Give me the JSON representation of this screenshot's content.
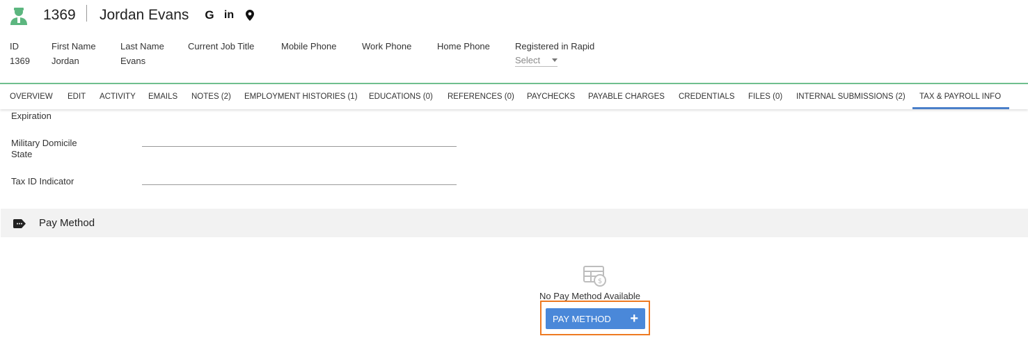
{
  "header": {
    "record_id": "1369",
    "name": "Jordan Evans",
    "social": {
      "google": "G",
      "linkedin": "in"
    }
  },
  "fields": {
    "id": {
      "label": "ID",
      "value": "1369"
    },
    "first_name": {
      "label": "First Name",
      "value": "Jordan"
    },
    "last_name": {
      "label": "Last Name",
      "value": "Evans"
    },
    "job_title": {
      "label": "Current Job Title",
      "value": ""
    },
    "mobile_phone": {
      "label": "Mobile Phone",
      "value": ""
    },
    "work_phone": {
      "label": "Work Phone",
      "value": ""
    },
    "home_phone": {
      "label": "Home Phone",
      "value": ""
    },
    "registered_rapid": {
      "label": "Registered in Rapid",
      "value": "Select"
    }
  },
  "tabs": [
    {
      "label": "OVERVIEW"
    },
    {
      "label": "EDIT"
    },
    {
      "label": "ACTIVITY"
    },
    {
      "label": "EMAILS"
    },
    {
      "label": "NOTES (2)"
    },
    {
      "label": "EMPLOYMENT HISTORIES (1)"
    },
    {
      "label": "EDUCATIONS (0)"
    },
    {
      "label": "REFERENCES (0)"
    },
    {
      "label": "PAYCHECKS"
    },
    {
      "label": "PAYABLE CHARGES"
    },
    {
      "label": "CREDENTIALS"
    },
    {
      "label": "FILES (0)"
    },
    {
      "label": "INTERNAL SUBMISSIONS (2)"
    },
    {
      "label": "TAX & PAYROLL INFO"
    }
  ],
  "tax_fields": {
    "expiration": "Expiration",
    "military_domicile_line1": "Military Domicile",
    "military_domicile_line2": "State",
    "tax_id_indicator": "Tax ID Indicator"
  },
  "pay_method": {
    "section_title": "Pay Method",
    "empty_text": "No Pay Method Available",
    "button_label": "PAY METHOD",
    "button_icon": "+"
  },
  "colors": {
    "accent_green": "#5cb67f",
    "tab_active": "#4a7fc9",
    "button_blue": "#4a88d9",
    "highlight_orange": "#ee7a22"
  }
}
